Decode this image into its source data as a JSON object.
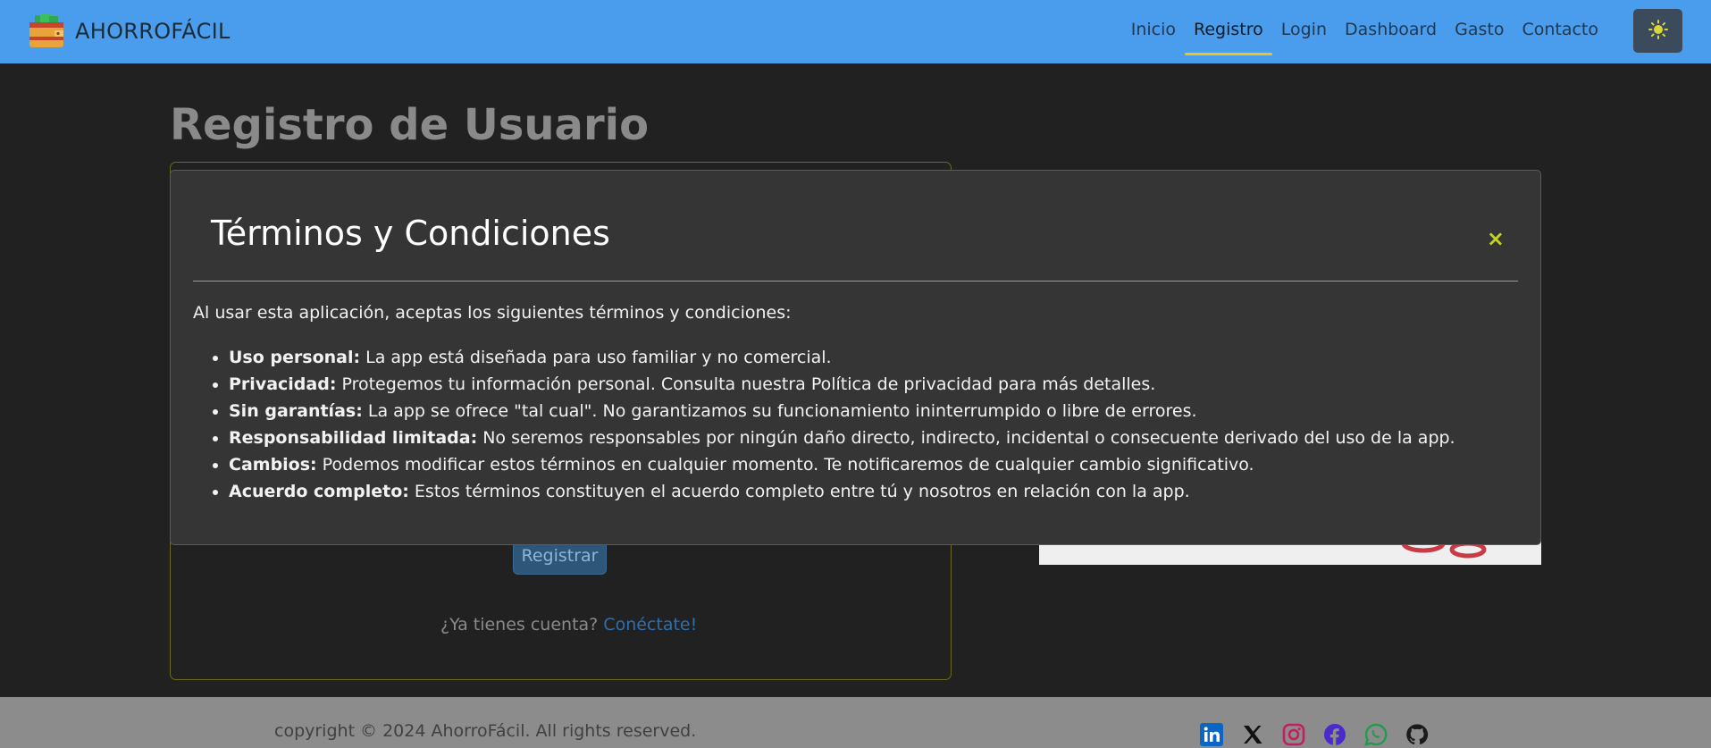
{
  "navbar": {
    "brand": "AHORROFÁCIL",
    "links": [
      {
        "label": "Inicio",
        "active": false
      },
      {
        "label": "Registro",
        "active": true
      },
      {
        "label": "Login",
        "active": false
      },
      {
        "label": "Dashboard",
        "active": false
      },
      {
        "label": "Gasto",
        "active": false
      },
      {
        "label": "Contacto",
        "active": false
      }
    ],
    "theme_toggle_icon": "sun-icon",
    "accent": "#f0c419",
    "background": "#4a9ded"
  },
  "page": {
    "title": "Registro de Usuario",
    "register_button": "Registrar",
    "have_account": "¿Ya tienes cuenta?",
    "login_link": "Conéctate!"
  },
  "modal": {
    "title": "Términos y Condiciones",
    "close": "×",
    "intro": "Al usar esta aplicación, aceptas los siguientes términos y condiciones:",
    "terms": [
      {
        "label": "Uso personal:",
        "text": " La app está diseñada para uso familiar y no comercial."
      },
      {
        "label": "Privacidad:",
        "text": " Protegemos tu información personal. Consulta nuestra Política de privacidad para más detalles."
      },
      {
        "label": "Sin garantías:",
        "text": " La app se ofrece \"tal cual\". No garantizamos su funcionamiento ininterrumpido o libre de errores."
      },
      {
        "label": "Responsabilidad limitada:",
        "text": " No seremos responsables por ningún daño directo, indirecto, incidental o consecuente derivado del uso de la app."
      },
      {
        "label": "Cambios:",
        "text": " Podemos modificar estos términos en cualquier momento. Te notificaremos de cualquier cambio significativo."
      },
      {
        "label": "Acuerdo completo:",
        "text": " Estos términos constituyen el acuerdo completo entre tú y nosotros en relación con la app."
      }
    ]
  },
  "footer": {
    "copyright": "copyright © 2024 AhorroFácil. All rights reserved.",
    "socials": [
      "linkedin-icon",
      "x-icon",
      "instagram-icon",
      "facebook-icon",
      "whatsapp-icon",
      "github-icon"
    ]
  }
}
